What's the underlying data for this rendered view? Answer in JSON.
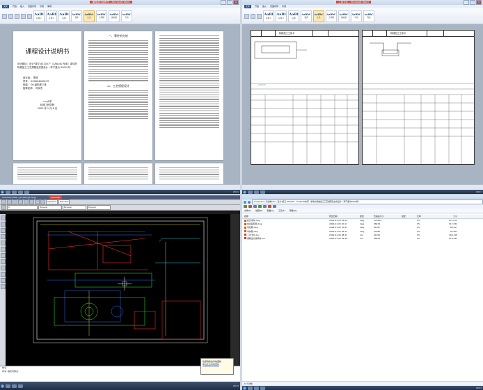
{
  "word_left": {
    "title": "课程设计说明书",
    "topic": "设计题目：设计\"拨叉 831007\"（CA6140 车床）零件的机械加工工艺规程及夹具设计（年产量为 5000 件）",
    "info": [
      {
        "label": "设计者",
        "value": "李德"
      },
      {
        "label": "学号",
        "value": "200624060219"
      },
      {
        "label": "班级",
        "value": "06 级机械三班"
      },
      {
        "label": "指导老师",
        "value": "刘永杰"
      }
    ],
    "school": "××大学",
    "college": "机械工程学院",
    "date": "2009 年 1 月 6 日",
    "page2_heading": "一、零件的分析",
    "page2_sub": "二、工艺规程设计"
  },
  "word_right": {
    "card_title": "机械加工工序卡",
    "card_numbers": [
      "2",
      "3",
      "4",
      "5"
    ]
  },
  "cad": {
    "title": "AutoCAD 2008 - [Drawing1.dwg]",
    "layer_combo": "Standard",
    "font_combo": "Standard",
    "linetype": "ByLayer",
    "command_lines": [
      "命令:",
      "命令: 指定对角点:"
    ],
    "notification_title": "检测到新的系统更新",
    "notification_link": "单击此处获取更新"
  },
  "explorer": {
    "path": "Computer ▸ 新加卷(E:) ▸ 设计\"拨叉 831007\"（CA6140车床）零件的机械加工工艺规程及夹具设计（年产量为5000件）",
    "menu": [
      "文件(F)",
      "编辑(E)",
      "查看(V)",
      "工具(T)",
      "帮助(H)"
    ],
    "columns": [
      "名称",
      "",
      "修改日期",
      "类型",
      "压缩后大小",
      "加密",
      "比率",
      "大小"
    ],
    "files": [
      {
        "name": "拨叉零件.dwg",
        "date": "2009-01-03 16:24",
        "type": "dwg",
        "packed": "123456",
        "ratio": "0%",
        "size": "871,072"
      },
      {
        "name": "夹具装配图.dwg",
        "date": "2009-01-05 20:11",
        "type": "dwg",
        "packed": "98234",
        "ratio": "0%",
        "size": "317,632"
      },
      {
        "name": "毛坯图.dwg",
        "date": "2009-01-02 10:47",
        "type": "dwg",
        "packed": "41287",
        "ratio": "0%",
        "size": "82,617"
      },
      {
        "name": "零件图.dwg",
        "date": "2009-01-02 09:15",
        "type": "dwg",
        "packed": "52380",
        "ratio": "0%",
        "size": "92,563"
      },
      {
        "name": "工序卡片.doc",
        "date": "2009-01-06 08:32",
        "type": "doc",
        "packed": "61924",
        "ratio": "0%",
        "size": "160,128"
      },
      {
        "name": "课程设计说明书.doc",
        "date": "2009-01-06 09:40",
        "type": "doc",
        "packed": "98452",
        "ratio": "0%",
        "size": "210,944"
      }
    ],
    "status": "6 个对象"
  },
  "taskbar": {
    "time": "20:41"
  }
}
